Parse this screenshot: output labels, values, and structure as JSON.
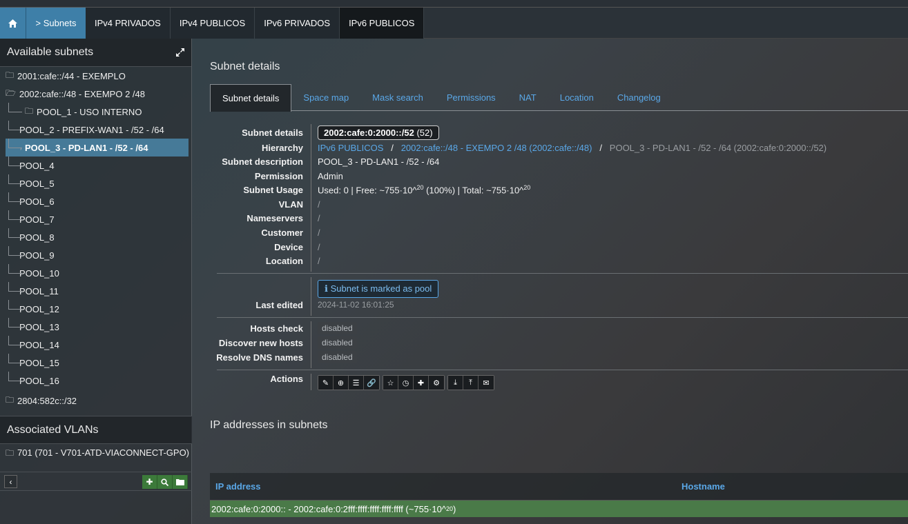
{
  "nav": {
    "home_icon": "home-icon",
    "subnets_label": "> Subnets",
    "sections": [
      "IPv4 PRIVADOS",
      "IPv4 PUBLICOS",
      "IPv6 PRIVADOS",
      "IPv6 PUBLICOS"
    ],
    "active_section": "IPv6 PUBLICOS"
  },
  "sidebar": {
    "title": "Available subnets",
    "expand_icon": "expand-icon",
    "tree": [
      {
        "label": "2001:cafe::/44 - EXEMPLO",
        "level": "root",
        "open": false
      },
      {
        "label": "2002:cafe::/48 - EXEMPO 2 /48",
        "level": "root",
        "open": true
      },
      {
        "label": "POOL_1 - USO INTERNO",
        "level": "child-folder"
      },
      {
        "label": "POOL_2 - PREFIX-WAN1 - /52 - /64",
        "level": "child"
      },
      {
        "label": "POOL_3 - PD-LAN1 - /52 - /64",
        "level": "child",
        "selected": true
      },
      {
        "label": "POOL_4",
        "level": "child"
      },
      {
        "label": "POOL_5",
        "level": "child"
      },
      {
        "label": "POOL_6",
        "level": "child"
      },
      {
        "label": "POOL_7",
        "level": "child"
      },
      {
        "label": "POOL_8",
        "level": "child"
      },
      {
        "label": "POOL_9",
        "level": "child"
      },
      {
        "label": "POOL_10",
        "level": "child"
      },
      {
        "label": "POOL_11",
        "level": "child"
      },
      {
        "label": "POOL_12",
        "level": "child"
      },
      {
        "label": "POOL_13",
        "level": "child"
      },
      {
        "label": "POOL_14",
        "level": "child"
      },
      {
        "label": "POOL_15",
        "level": "child"
      },
      {
        "label": "POOL_16",
        "level": "child"
      },
      {
        "label": "2804:582c::/32",
        "level": "root",
        "open": false
      }
    ],
    "vlans_title": "Associated VLANs",
    "vlan_item": "701 (701 - V701-ATD-VIACONNECT-GPO)"
  },
  "main": {
    "details_title": "Subnet details",
    "tabs": [
      "Subnet details",
      "Space map",
      "Mask search",
      "Permissions",
      "NAT",
      "Location",
      "Changelog"
    ],
    "active_tab": "Subnet details",
    "labels": {
      "subnet_details": "Subnet details",
      "hierarchy": "Hierarchy",
      "description": "Subnet description",
      "permission": "Permission",
      "usage": "Subnet Usage",
      "vlan": "VLAN",
      "nameservers": "Nameservers",
      "customer": "Customer",
      "device": "Device",
      "location": "Location",
      "last_edited": "Last edited",
      "hosts_check": "Hosts check",
      "discover": "Discover new hosts",
      "resolve": "Resolve DNS names",
      "actions": "Actions"
    },
    "values": {
      "subnet": "2002:cafe:0:2000::/52",
      "subnet_mask": "(52)",
      "hierarchy_1": "IPv6 PUBLICOS",
      "hierarchy_sep": "/",
      "hierarchy_2": "2002:cafe::/48 - EXEMPO 2 /48 (2002:cafe::/48)",
      "hierarchy_3": "POOL_3 - PD-LAN1 - /52 - /64 (2002:cafe:0:2000::/52)",
      "description": "POOL_3 - PD-LAN1 - /52 - /64",
      "permission": "Admin",
      "usage_prefix": "Used: 0 | Free: ~755·10^",
      "usage_exp": "20",
      "usage_mid": " (100%) | Total: ~755·10^",
      "usage_exp2": "20",
      "empty": "/",
      "pool_badge": "Subnet is marked as pool",
      "last_edited": "2024-11-02 16:01:25",
      "disabled": "disabled"
    },
    "ips_title": "IP addresses in subnets",
    "ip_table": {
      "col_ip": "IP address",
      "col_host": "Hostname",
      "range_prefix": "2002:cafe:0:2000:: - 2002:cafe:0:2fff:ffff:ffff:ffff:ffff (~755·10^",
      "range_exp": "20",
      "range_suffix": ")"
    }
  }
}
